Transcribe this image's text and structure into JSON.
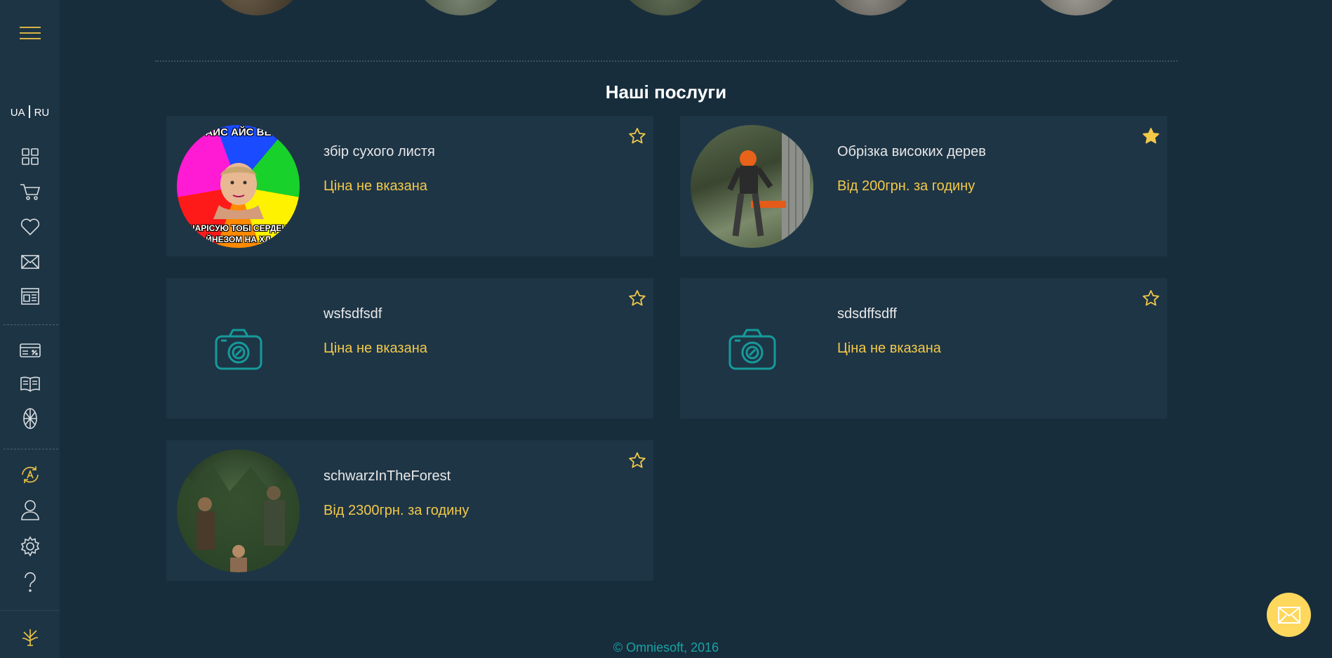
{
  "sidebar": {
    "lang_ua": "UA",
    "lang_ru": "RU",
    "icons": [
      "menu-icon",
      "grid-icon",
      "cart-icon",
      "heart-icon",
      "mail-icon",
      "news-icon",
      "discount-card-icon",
      "book-icon",
      "aperture-icon",
      "sync-a-icon",
      "user-icon",
      "gear-icon",
      "question-icon",
      "tree-logo-icon"
    ]
  },
  "services": {
    "title": "Наші послуги",
    "items": [
      {
        "name": "збір сухого листя",
        "price": "Ціна не вказана",
        "favorite": false,
        "image": "meme-photo"
      },
      {
        "name": "Обрізка високих дерев",
        "price": "Від 200грн. за годину",
        "favorite": true,
        "image": "chainsaw-photo"
      },
      {
        "name": "wsfsdfsdf",
        "price": "Ціна не вказана",
        "favorite": false,
        "image": "camera-placeholder"
      },
      {
        "name": "sdsdffsdff",
        "price": "Ціна не вказана",
        "favorite": false,
        "image": "camera-placeholder"
      },
      {
        "name": "schwarzInTheForest",
        "price": "Від 2300грн. за годину",
        "favorite": false,
        "image": "forest-photo"
      }
    ]
  },
  "meme_text": {
    "top": "АЙС АЙС ВЕ",
    "bottom": "НАРІСУЮ ТОБІ СЕРДЕН",
    "bottom2": "ЙНЕЗОМ НА ХЛ"
  },
  "footer": {
    "copyright": "© Omniesoft, 2016"
  },
  "colors": {
    "background": "#172d3c",
    "sidebar": "#1d3444",
    "card": "#1e3546",
    "accent": "#f3c948",
    "teal": "#1aa3a3"
  }
}
